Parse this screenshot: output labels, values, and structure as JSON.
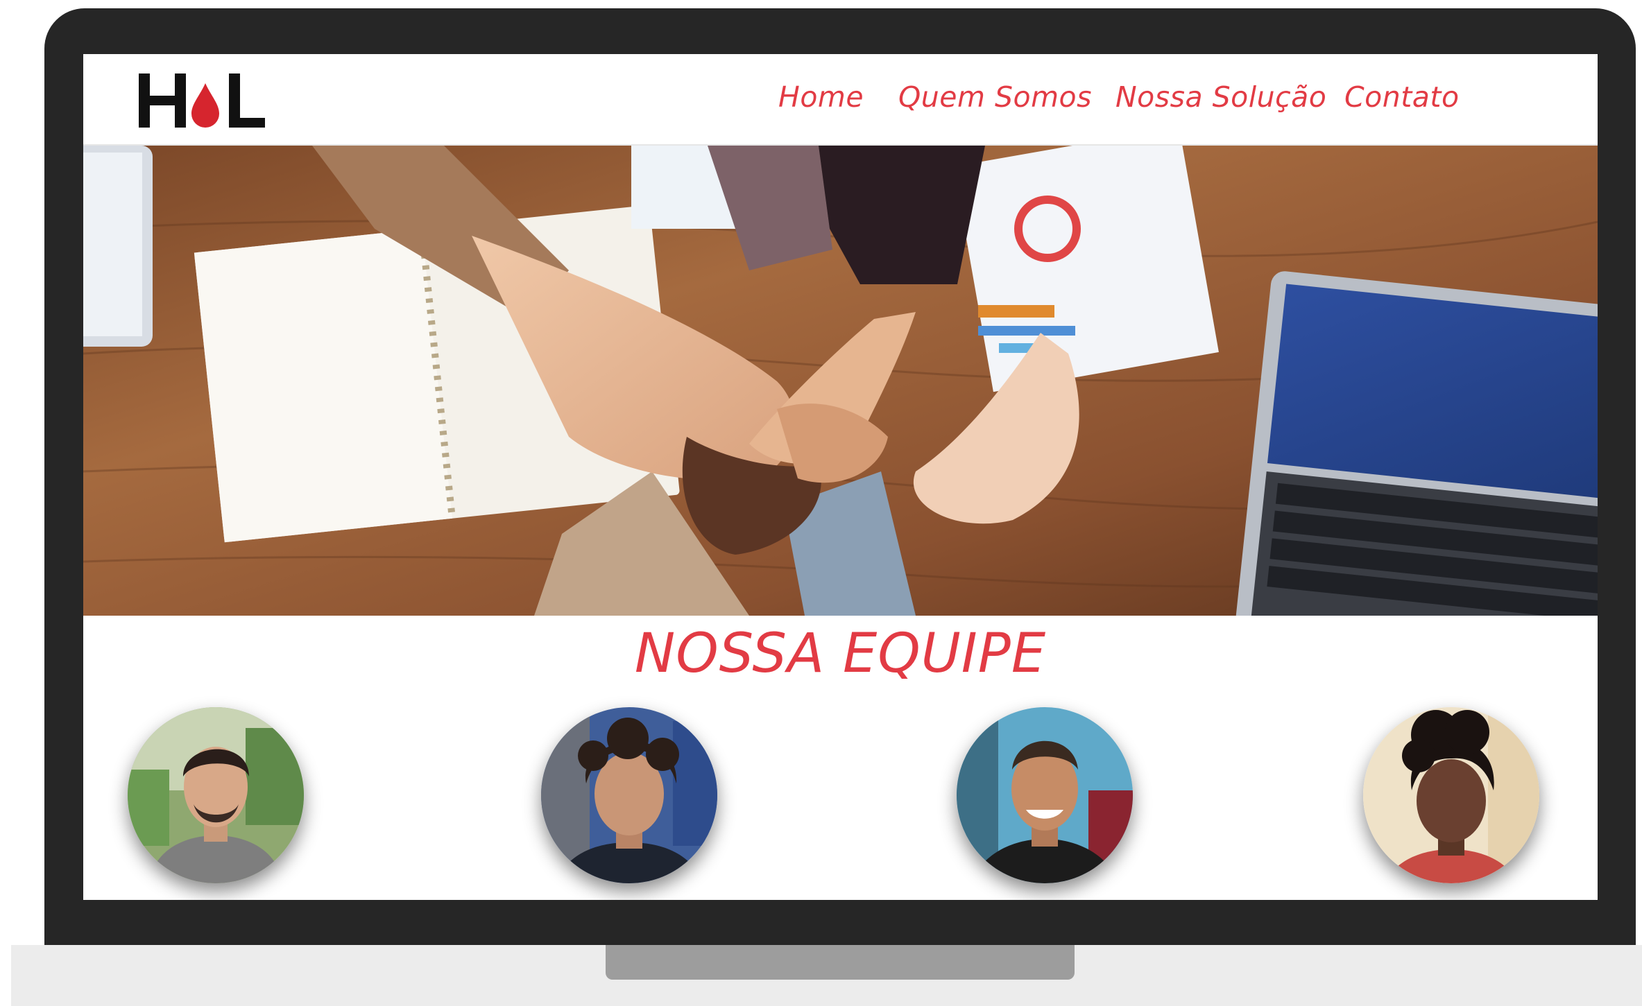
{
  "logo": {
    "text": "HL"
  },
  "nav": {
    "items": [
      {
        "label": "Home"
      },
      {
        "label": "Quem Somos"
      },
      {
        "label": "Nossa Solução"
      },
      {
        "label": "Contato"
      }
    ]
  },
  "hero": {
    "image": "team-hands-stacked-photo"
  },
  "team": {
    "title": "NOSSA EQUIPE",
    "members": [
      {
        "photo": "team-member-photo"
      },
      {
        "photo": "team-member-photo"
      },
      {
        "photo": "team-member-photo"
      },
      {
        "photo": "team-member-photo"
      }
    ]
  },
  "colors": {
    "accent": "#e23b44",
    "laptop_frame": "#262626",
    "laptop_base": "#ececec"
  }
}
